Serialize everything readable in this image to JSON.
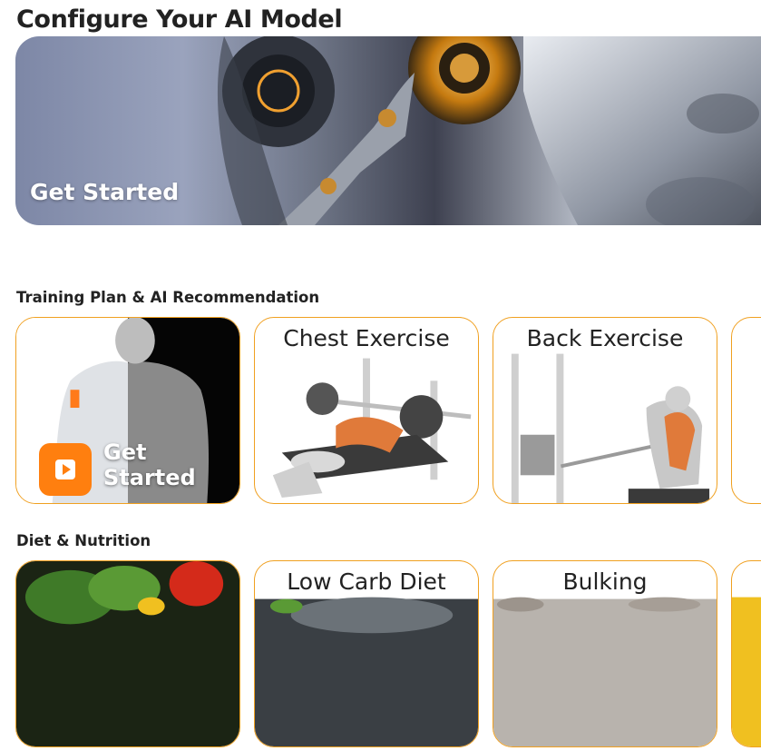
{
  "page": {
    "title": "Configure Your AI Model"
  },
  "hero": {
    "label": "Get Started",
    "image": "robot-head-illustration"
  },
  "training": {
    "section_title": "Training Plan & AI Recommendation",
    "cards": [
      {
        "label": "Get Started",
        "image": "robot-man-illustration",
        "icon": "play-icon"
      },
      {
        "title": "Chest Exercise",
        "image": "bench-press-illustration"
      },
      {
        "title": "Back Exercise",
        "image": "cable-row-illustration"
      }
    ]
  },
  "diet": {
    "section_title": "Diet & Nutrition",
    "cards": [
      {
        "image": "vegetables-photo"
      },
      {
        "title": "Low Carb Diet",
        "image": "low-carb-food-photo"
      },
      {
        "title": "Bulking",
        "image": "bulking-food-photo"
      }
    ]
  },
  "colors": {
    "accent": "#ff7f0f",
    "card_border": "#f0a020"
  }
}
